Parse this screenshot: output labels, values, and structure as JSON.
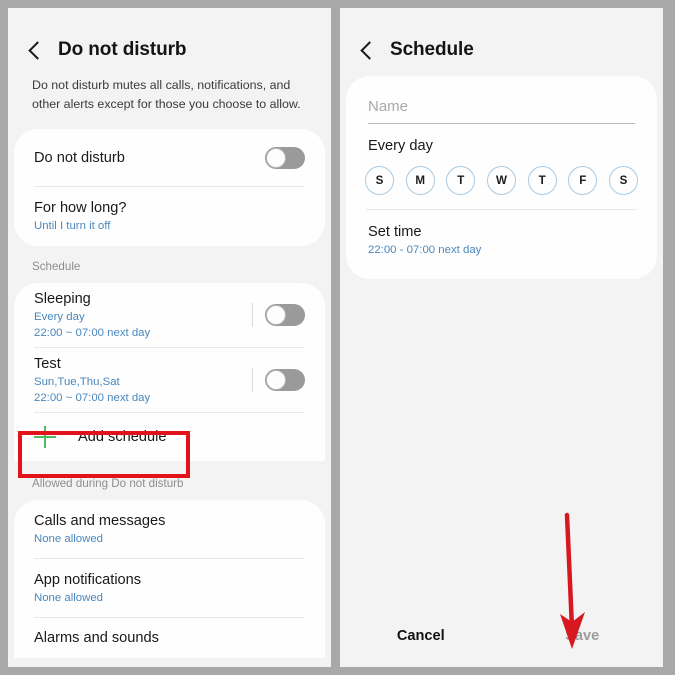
{
  "left_panel": {
    "header": {
      "back_icon": "back-chevron-icon",
      "title": "Do not disturb"
    },
    "description": "Do not disturb mutes all calls, notifications, and other alerts except for those you choose to allow.",
    "main_card": {
      "dnd_row": {
        "title": "Do not disturb",
        "toggle_state": "off"
      },
      "duration_row": {
        "title": "For how long?",
        "value": "Until I turn it off"
      }
    },
    "schedule_section": {
      "label": "Schedule",
      "items": [
        {
          "title": "Sleeping",
          "days": "Every day",
          "time": "22:00 ~ 07:00 next day",
          "toggle_state": "off"
        },
        {
          "title": "Test",
          "days": "Sun,Tue,Thu,Sat",
          "time": "22:00 ~ 07:00 next day",
          "toggle_state": "off"
        }
      ],
      "add_schedule": {
        "icon": "plus-icon",
        "label": "Add schedule",
        "highlighted": true
      }
    },
    "allowed_section": {
      "label": "Allowed during Do not disturb",
      "items": [
        {
          "title": "Calls and messages",
          "value": "None allowed"
        },
        {
          "title": "App notifications",
          "value": "None allowed"
        },
        {
          "title": "Alarms and sounds",
          "value": ""
        }
      ]
    }
  },
  "right_panel": {
    "header": {
      "back_icon": "back-chevron-icon",
      "title": "Schedule"
    },
    "name_field": {
      "placeholder": "Name",
      "value": ""
    },
    "repeat_label": "Every day",
    "days": [
      {
        "letter": "S",
        "selected": false
      },
      {
        "letter": "M",
        "selected": false
      },
      {
        "letter": "T",
        "selected": false
      },
      {
        "letter": "W",
        "selected": false
      },
      {
        "letter": "T",
        "selected": false
      },
      {
        "letter": "F",
        "selected": false
      },
      {
        "letter": "S",
        "selected": false
      }
    ],
    "set_time": {
      "title": "Set time",
      "value": "22:00 - 07:00 next day"
    },
    "bottom_bar": {
      "cancel_label": "Cancel",
      "save_label": "Save"
    },
    "annotation": {
      "type": "arrow",
      "points_to": "Save",
      "color": "#d81820"
    }
  },
  "colors": {
    "accent_blue": "#4a87bd",
    "highlight_red": "#e2121b",
    "plus_green": "#4bbd5e",
    "page_bg": "#f3f3f3",
    "card_bg": "#fefefe",
    "outer_bg": "#a8a8a8"
  }
}
